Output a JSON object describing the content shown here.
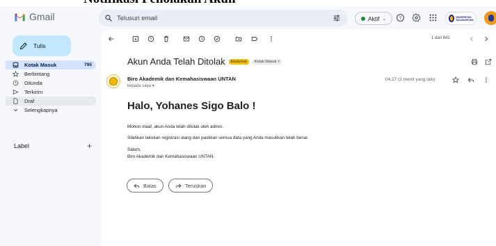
{
  "caption": {
    "text": "Notifikasi Penolakan Akun"
  },
  "app": {
    "name": "Gmail",
    "search_placeholder": "Telusuri email",
    "status": "Aktif",
    "status_color": "#1e8e3e",
    "university_logo_text": "UNIVERSITAS TANJUNGPURA"
  },
  "sidebar": {
    "compose_label": "Tulis",
    "items": [
      {
        "label": "Kotak Masuk",
        "count": "795",
        "icon": "inbox-icon"
      },
      {
        "label": "Berbintang",
        "icon": "star-icon"
      },
      {
        "label": "Ditunda",
        "icon": "clock-icon"
      },
      {
        "label": "Terkirim",
        "icon": "send-icon"
      },
      {
        "label": "Draf",
        "icon": "draft-icon"
      },
      {
        "label": "Selengkapnya",
        "icon": "chevron-down-icon"
      }
    ],
    "labels_header": "Label",
    "labels_add": "+"
  },
  "toolbar": {
    "pager": "1 dari 841"
  },
  "email": {
    "subject": "Akun Anda Telah Ditolak",
    "badge_external": "Eksternal",
    "badge_inbox": "Kotak Masuk ×",
    "sender": "Biro Akademik dan Kemahasiswaan UNTAN",
    "to": "kepada saya ▾",
    "time": "04.27 (2 menit yang lalu)",
    "greeting": "Halo, Yohanes Sigo Balo !",
    "body": [
      "Mohon maaf, akun Anda telah ditolak oleh admin.",
      "Silahkan lakukan registrasi ulang dan pastikan semua data yang Anda masukkan telah benar.",
      "Salam,",
      "Biro Akademik dan Kemahasiswaan UNTAN."
    ]
  },
  "actions": {
    "reply": "Balas",
    "forward": "Teruskan"
  },
  "colors": {
    "compose_bg": "#c2e7ff",
    "active_nav_bg": "#d3e3fd",
    "external_badge": "#f4c20d"
  }
}
